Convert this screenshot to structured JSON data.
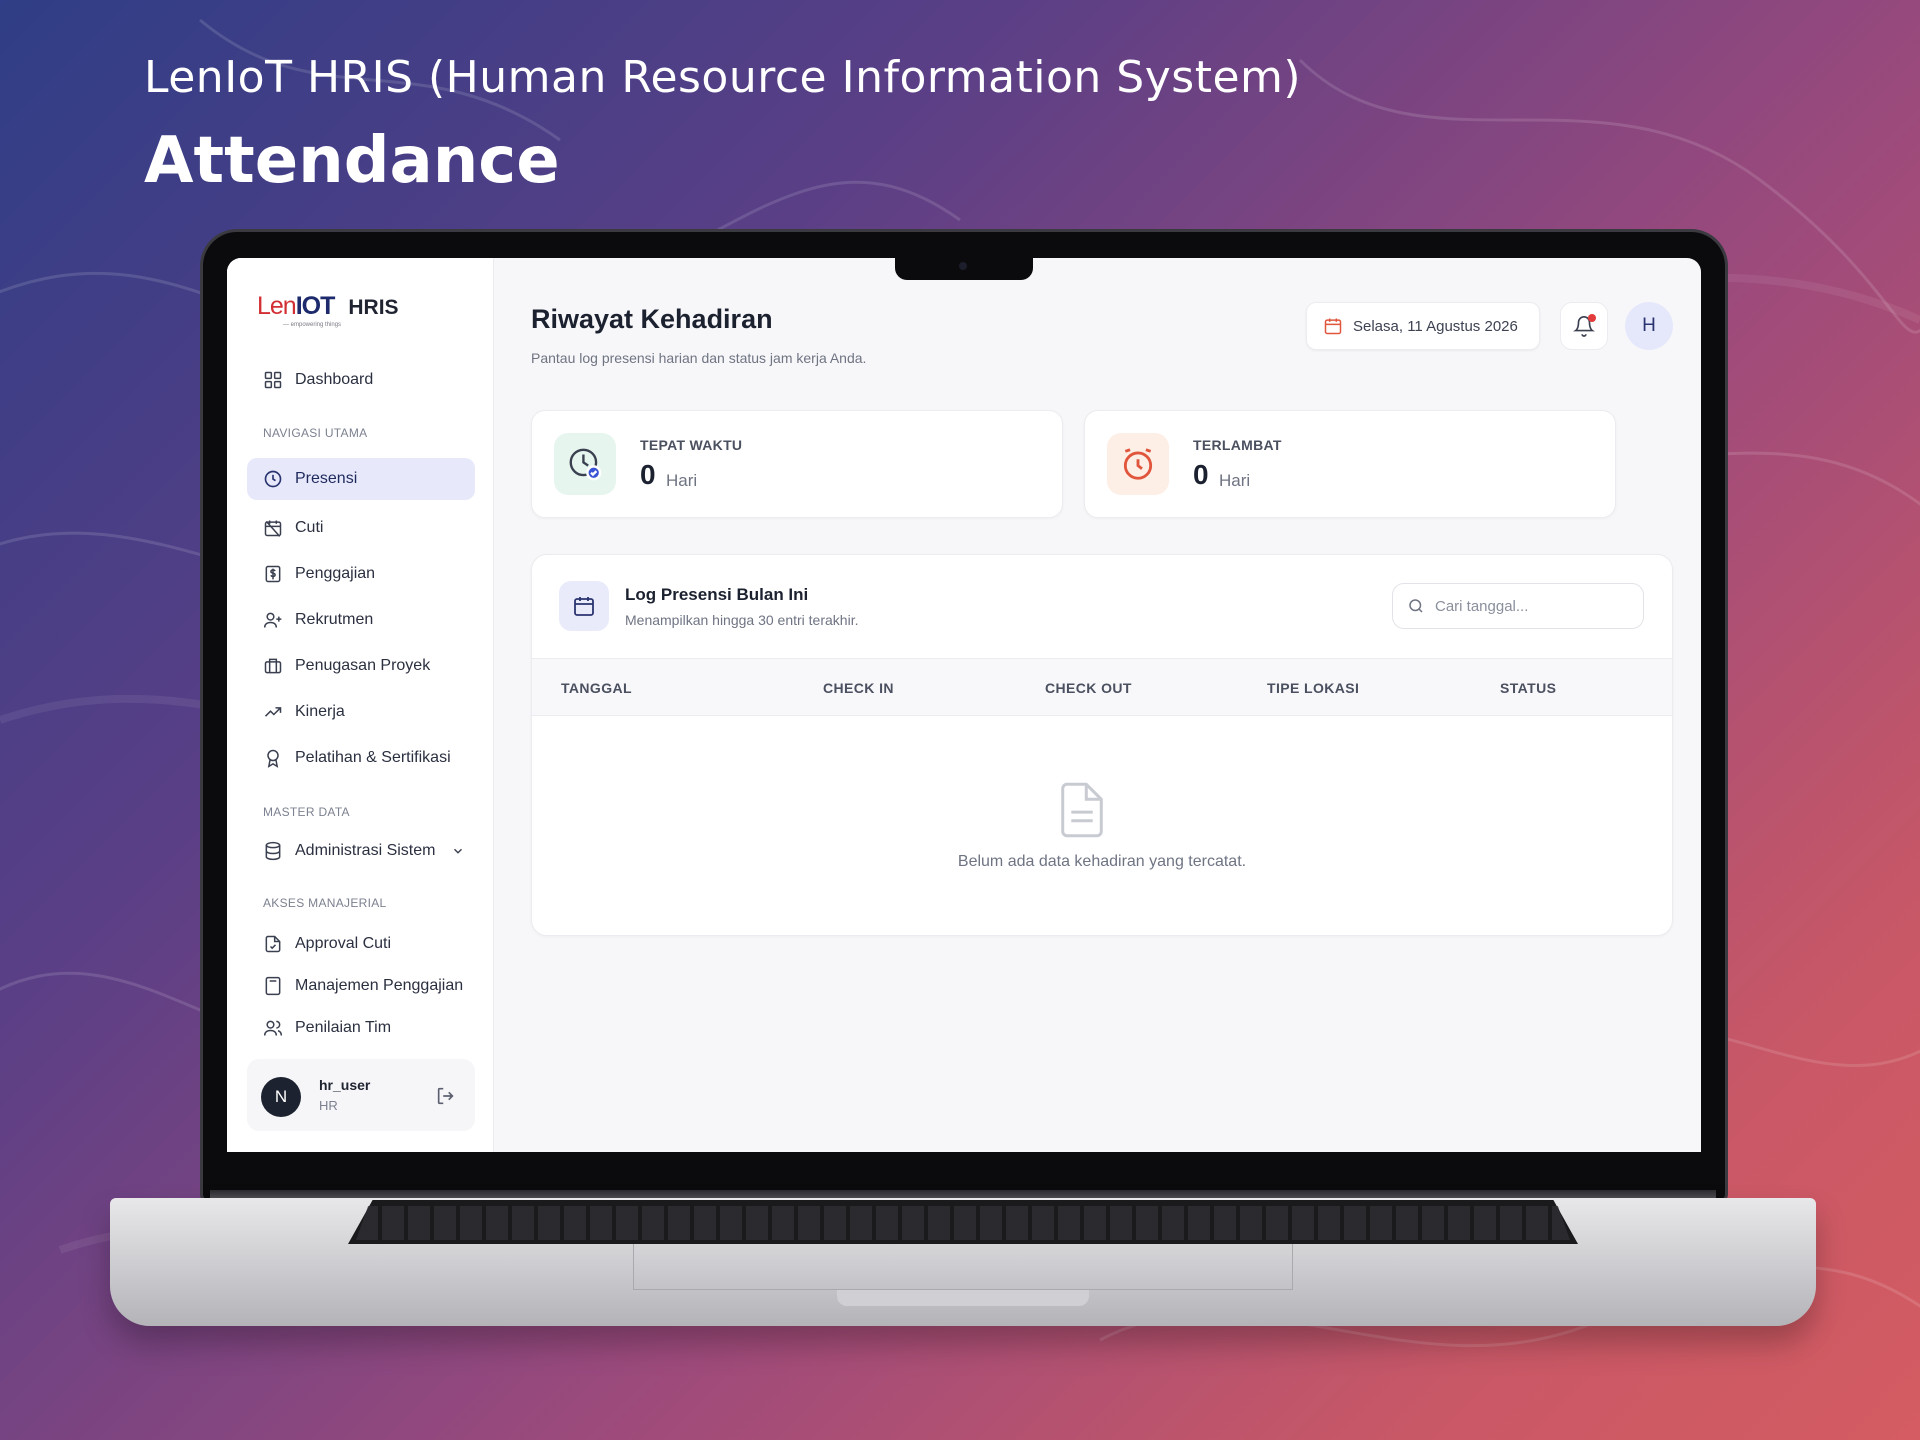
{
  "hero": {
    "subtitle": "LenIoT HRIS (Human Resource Information System)",
    "title": "Attendance"
  },
  "app": {
    "logo_text": "LenIOT",
    "logo_tagline": "— empowering things",
    "product": "HRIS"
  },
  "sidebar": {
    "dashboard": {
      "label": "Dashboard",
      "icon": "grid-icon"
    },
    "sections": [
      {
        "title": "NAVIGASI UTAMA"
      },
      {
        "title": "MASTER DATA"
      },
      {
        "title": "AKSES MANAJERIAL"
      }
    ],
    "main_nav": [
      {
        "label": "Presensi",
        "icon": "clock-icon",
        "active": true
      },
      {
        "label": "Cuti",
        "icon": "calendar-off-icon"
      },
      {
        "label": "Penggajian",
        "icon": "dollar-receipt-icon"
      },
      {
        "label": "Rekrutmen",
        "icon": "user-plus-icon"
      },
      {
        "label": "Penugasan Proyek",
        "icon": "briefcase-icon"
      },
      {
        "label": "Kinerja",
        "icon": "trending-up-icon"
      },
      {
        "label": "Pelatihan & Sertifikasi",
        "icon": "award-icon"
      }
    ],
    "master_data": [
      {
        "label": "Administrasi Sistem",
        "icon": "database-icon"
      }
    ],
    "manager_nav": [
      {
        "label": "Approval Cuti",
        "icon": "file-check-icon"
      },
      {
        "label": "Manajemen Penggajian",
        "icon": "calculator-icon"
      },
      {
        "label": "Penilaian Tim",
        "icon": "users-icon"
      }
    ],
    "user": {
      "initial": "N",
      "name": "hr_user",
      "role": "HR"
    }
  },
  "header": {
    "title": "Riwayat Kehadiran",
    "subtitle": "Pantau log presensi harian dan status jam kerja Anda.",
    "date": "Selasa, 11 Agustus 2026",
    "avatar_initial": "H"
  },
  "stats": [
    {
      "label": "TEPAT WAKTU",
      "value": "0",
      "unit": "Hari",
      "color": "#2fa26b",
      "bg": "#e6f6ee"
    },
    {
      "label": "TERLAMBAT",
      "value": "0",
      "unit": "Hari",
      "color": "#e0553b",
      "bg": "#fdeee6"
    }
  ],
  "log": {
    "title": "Log Presensi Bulan Ini",
    "subtitle": "Menampilkan hingga 30 entri terakhir.",
    "search_placeholder": "Cari tanggal...",
    "columns": [
      "TANGGAL",
      "CHECK IN",
      "CHECK OUT",
      "TIPE LOKASI",
      "STATUS"
    ],
    "rows": [],
    "empty_text": "Belum ada data kehadiran yang tercatat."
  },
  "colors": {
    "accent": "#2a3470",
    "active_bg": "#e7e9fb",
    "brand_red": "#d22f34"
  }
}
